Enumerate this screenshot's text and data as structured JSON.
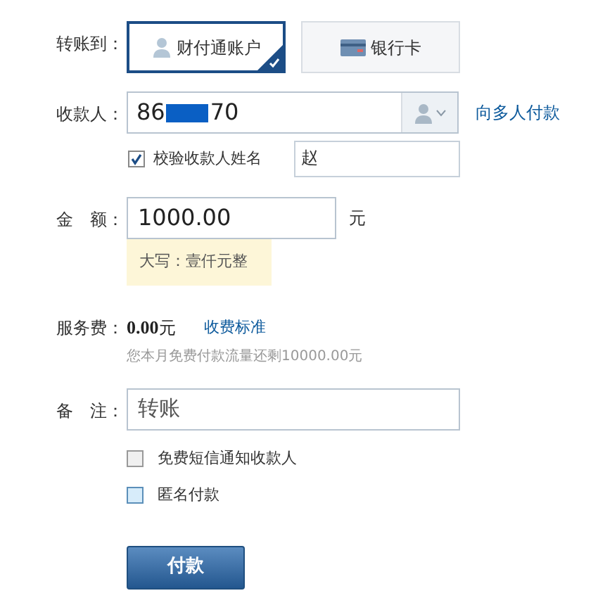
{
  "transfer_to": {
    "label": "转账到：",
    "options": [
      {
        "label": "财付通账户",
        "kind": "account",
        "selected": true
      },
      {
        "label": "银行卡",
        "kind": "card",
        "selected": false
      }
    ]
  },
  "recipient": {
    "label": "收款人：",
    "value_start": "86",
    "value_end": "70",
    "redacted": true,
    "link": "向多人付款",
    "verify": {
      "label": "校验收款人姓名",
      "checked": true,
      "value": "赵"
    }
  },
  "amount": {
    "label": "金　额：",
    "value": "1000.00",
    "unit": "元",
    "uppercase": "大写：壹仟元整"
  },
  "fee": {
    "label": "服务费：",
    "value": "0.00",
    "unit": "元",
    "link": "收费标准",
    "note": "您本月免费付款流量还剩10000.00元"
  },
  "remark": {
    "label": "备　注：",
    "value": "转账"
  },
  "options": [
    {
      "label": "免费短信通知收款人",
      "checked": false
    },
    {
      "label": "匿名付款",
      "checked": false,
      "highlighted": true
    }
  ],
  "submit": "付款"
}
